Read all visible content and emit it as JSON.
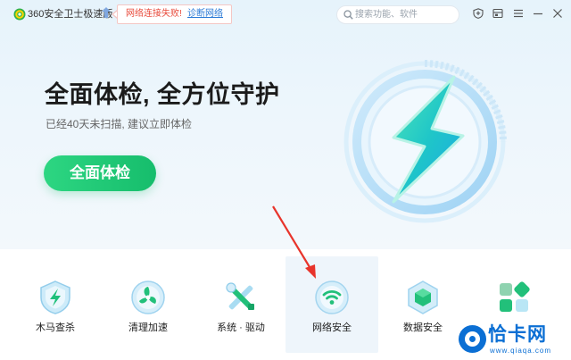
{
  "titlebar": {
    "app_title": "360安全卫士极速版",
    "notification": {
      "error_text": "网络连接失败!",
      "link_text": "诊断网络"
    },
    "search": {
      "placeholder": "搜索功能、软件"
    },
    "icons": [
      "shield-icon",
      "skin-icon",
      "menu-icon",
      "minimize-icon",
      "close-icon"
    ]
  },
  "hero": {
    "headline": "全面体检, 全方位守护",
    "subline": "已经40天未扫描, 建议立即体检",
    "scan_button": "全面体检"
  },
  "tools": [
    {
      "label": "木马查杀",
      "icon": "trojan-shield-icon"
    },
    {
      "label": "清理加速",
      "icon": "fan-cleanup-icon"
    },
    {
      "label": "系统 · 驱动",
      "icon": "tools-icon"
    },
    {
      "label": "网络安全",
      "icon": "wifi-icon",
      "selected": true
    },
    {
      "label": "数据安全",
      "icon": "data-cube-icon"
    },
    {
      "label": "",
      "icon": "more-apps-icon"
    }
  ],
  "watermark": {
    "text": "恰卡网",
    "url": "www.qiaqa.com"
  },
  "colors": {
    "accent_green": "#1dc874",
    "link_blue": "#2b7ad6",
    "error_red": "#e84b3c",
    "bolt_teal": "#29d3c4"
  }
}
